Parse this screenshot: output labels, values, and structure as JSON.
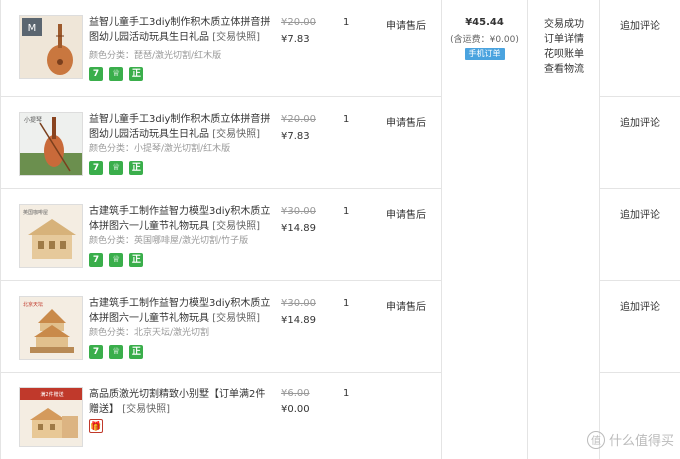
{
  "items": [
    {
      "title": "益智儿童手工3diy制作积木质立体拼音拼图幼儿园活动玩具生日礼品",
      "snapshot": "[交易快照]",
      "sku": "颜色分类：琵琶/激光切割/红木版",
      "orig_price": "¥20.00",
      "price": "¥7.83",
      "qty": "1",
      "aftersale": "申请售后",
      "comment": "追加评论",
      "image_icon": "pipa-instrument-icon",
      "badges": [
        "7",
        "盾",
        "正"
      ]
    },
    {
      "title": "益智儿童手工3diy制作积木质立体拼音拼图幼儿园活动玩具生日礼品",
      "snapshot": "[交易快照]",
      "sku": "颜色分类：小提琴/激光切割/红木版",
      "orig_price": "¥20.00",
      "price": "¥7.83",
      "qty": "1",
      "aftersale": "申请售后",
      "comment": "追加评论",
      "image_icon": "violin-icon",
      "badges": [
        "7",
        "盾",
        "正"
      ]
    },
    {
      "title": "古建筑手工制作益智力模型3diy积木质立体拼图六一儿童节礼物玩具",
      "snapshot": "[交易快照]",
      "sku": "颜色分类：英国哪啡屋/激光切割/竹子版",
      "orig_price": "¥30.00",
      "price": "¥14.89",
      "qty": "1",
      "aftersale": "申请售后",
      "comment": "追加评论",
      "image_icon": "house-model-icon",
      "badges": [
        "7",
        "盾",
        "正"
      ]
    },
    {
      "title": "古建筑手工制作益智力模型3diy积木质立体拼图六一儿童节礼物玩具",
      "snapshot": "[交易快照]",
      "sku": "颜色分类：北京天坛/激光切割",
      "orig_price": "¥30.00",
      "price": "¥14.89",
      "qty": "1",
      "aftersale": "申请售后",
      "comment": "追加评论",
      "image_icon": "temple-model-icon",
      "badges": [
        "7",
        "盾",
        "正"
      ]
    },
    {
      "title": "高品质激光切割精致小别墅【订单满2件赠送】",
      "snapshot": "[交易快照]",
      "sku": "",
      "orig_price": "¥6.00",
      "price": "¥0.00",
      "qty": "1",
      "aftersale": "",
      "comment": "",
      "image_icon": "villa-model-icon",
      "badges": [
        "gift"
      ]
    }
  ],
  "order": {
    "total": "¥45.44",
    "shipping": "(含运费：¥0.00)",
    "mobile_tag": "手机订单",
    "status_lines": [
      "交易成功",
      "订单详情",
      "花呗账单",
      "查看物流"
    ]
  },
  "watermark": {
    "text": "什么值得买",
    "icon": "zhi-logo-icon",
    "logo_char": "值"
  },
  "colors": {
    "badge_green": "#3aae4b",
    "mobile_tag": "#4aa3df",
    "gift_red": "#c0392b"
  }
}
